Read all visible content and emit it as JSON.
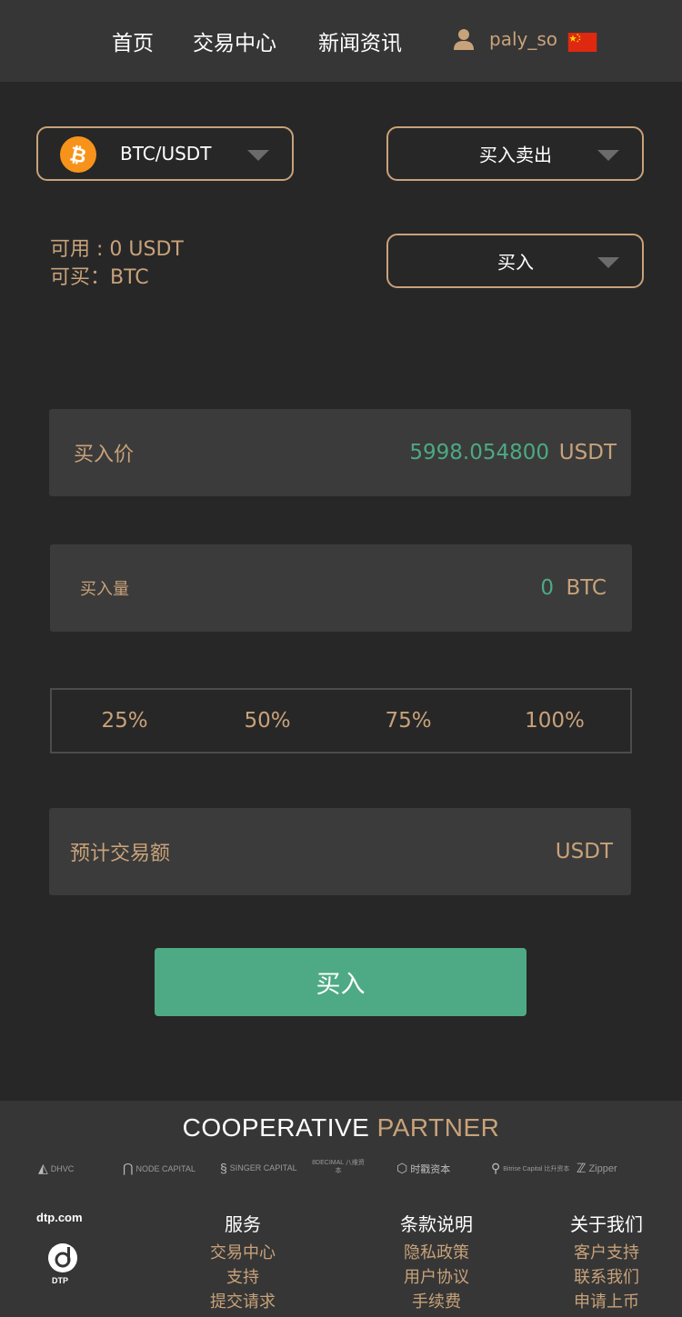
{
  "nav": {
    "home": "首页",
    "trade_center": "交易中心",
    "news": "新闻资讯",
    "username": "paly_so"
  },
  "pair_select": {
    "label": "BTC/USDT"
  },
  "mode_select": {
    "label": "买入卖出"
  },
  "side_select": {
    "label": "买入"
  },
  "balance": {
    "available": "可用 : 0 USDT",
    "can_buy": "可买：BTC"
  },
  "price_field": {
    "label": "买入价",
    "value": "5998.054800",
    "unit": "USDT"
  },
  "amount_field": {
    "label": "买入量",
    "value": "0",
    "unit": "BTC"
  },
  "percent_options": [
    "25%",
    "50%",
    "75%",
    "100%"
  ],
  "estimate_field": {
    "label": "预计交易额",
    "unit": "USDT"
  },
  "submit": {
    "label": "买入"
  },
  "footer": {
    "title_part1": "COOPERATIVE",
    "title_part2": "PARTNER",
    "partners": [
      "DHVC",
      "NODE CAPITAL",
      "SINGER CAPITAL",
      "8DECIMAL 八维资本",
      "时戳资本",
      "Bitrise Capital 比升资本",
      "Zipper"
    ],
    "brand_domain": "dtp.com",
    "brand_name": "DTP",
    "columns": [
      {
        "heading": "服务",
        "links": [
          "交易中心",
          "支持",
          "提交请求"
        ]
      },
      {
        "heading": "条款说明",
        "links": [
          "隐私政策",
          "用户协议",
          "手续费"
        ]
      },
      {
        "heading": "关于我们",
        "links": [
          "客户支持",
          "联系我们",
          "申请上币"
        ]
      }
    ]
  },
  "colors": {
    "background": "#272727",
    "panel": "#363636",
    "field": "#3b3b3b",
    "accent_gold": "#c8a27a",
    "accent_green": "#4eaa84",
    "text_white": "#ffffff"
  },
  "icons": {
    "user": "user-icon",
    "flag": "china-flag-icon",
    "coin": "bitcoin-icon",
    "caret": "caret-down-icon",
    "brand": "dtp-logo-icon"
  }
}
